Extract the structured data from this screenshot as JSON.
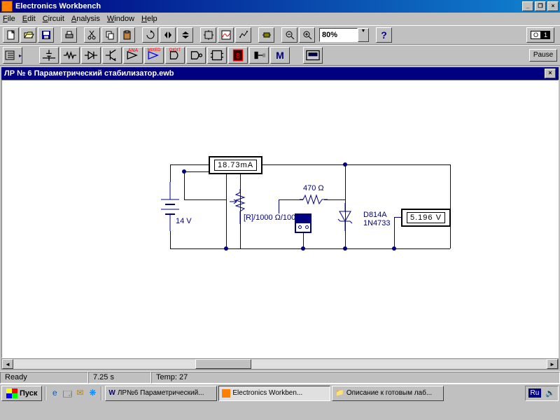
{
  "app": {
    "title": "Electronics Workbench"
  },
  "menu": {
    "file": "File",
    "edit": "Edit",
    "circuit": "Circuit",
    "analysis": "Analysis",
    "window": "Window",
    "help": "Help"
  },
  "toolbar": {
    "zoom": "80%",
    "help": "?",
    "pause": "Pause",
    "switch_on": "1",
    "switch_off": "O"
  },
  "parts_labels": {
    "ana": "ANA",
    "mixed": "MIXED",
    "digit": "DIGIT"
  },
  "doc": {
    "title": "ЛР № 6 Параметрический стабилизатор.ewb"
  },
  "circuit": {
    "ammeter": "18.73mA",
    "voltmeter": "5.196   V",
    "r1_label": "470 Ω",
    "pot_label": "[R]/1000 Ω/100%",
    "vsrc_label": "14 V",
    "diode_model": "D814A",
    "diode_part": "1N4733"
  },
  "status": {
    "ready": "Ready",
    "time": "7.25 s",
    "temp": "Temp:  27"
  },
  "taskbar": {
    "start": "Пуск",
    "task1": "ЛР№6 Параметрический...",
    "task2": "Electronics Workben...",
    "task3": "Описание к готовым лаб...",
    "lang": "Ru"
  }
}
